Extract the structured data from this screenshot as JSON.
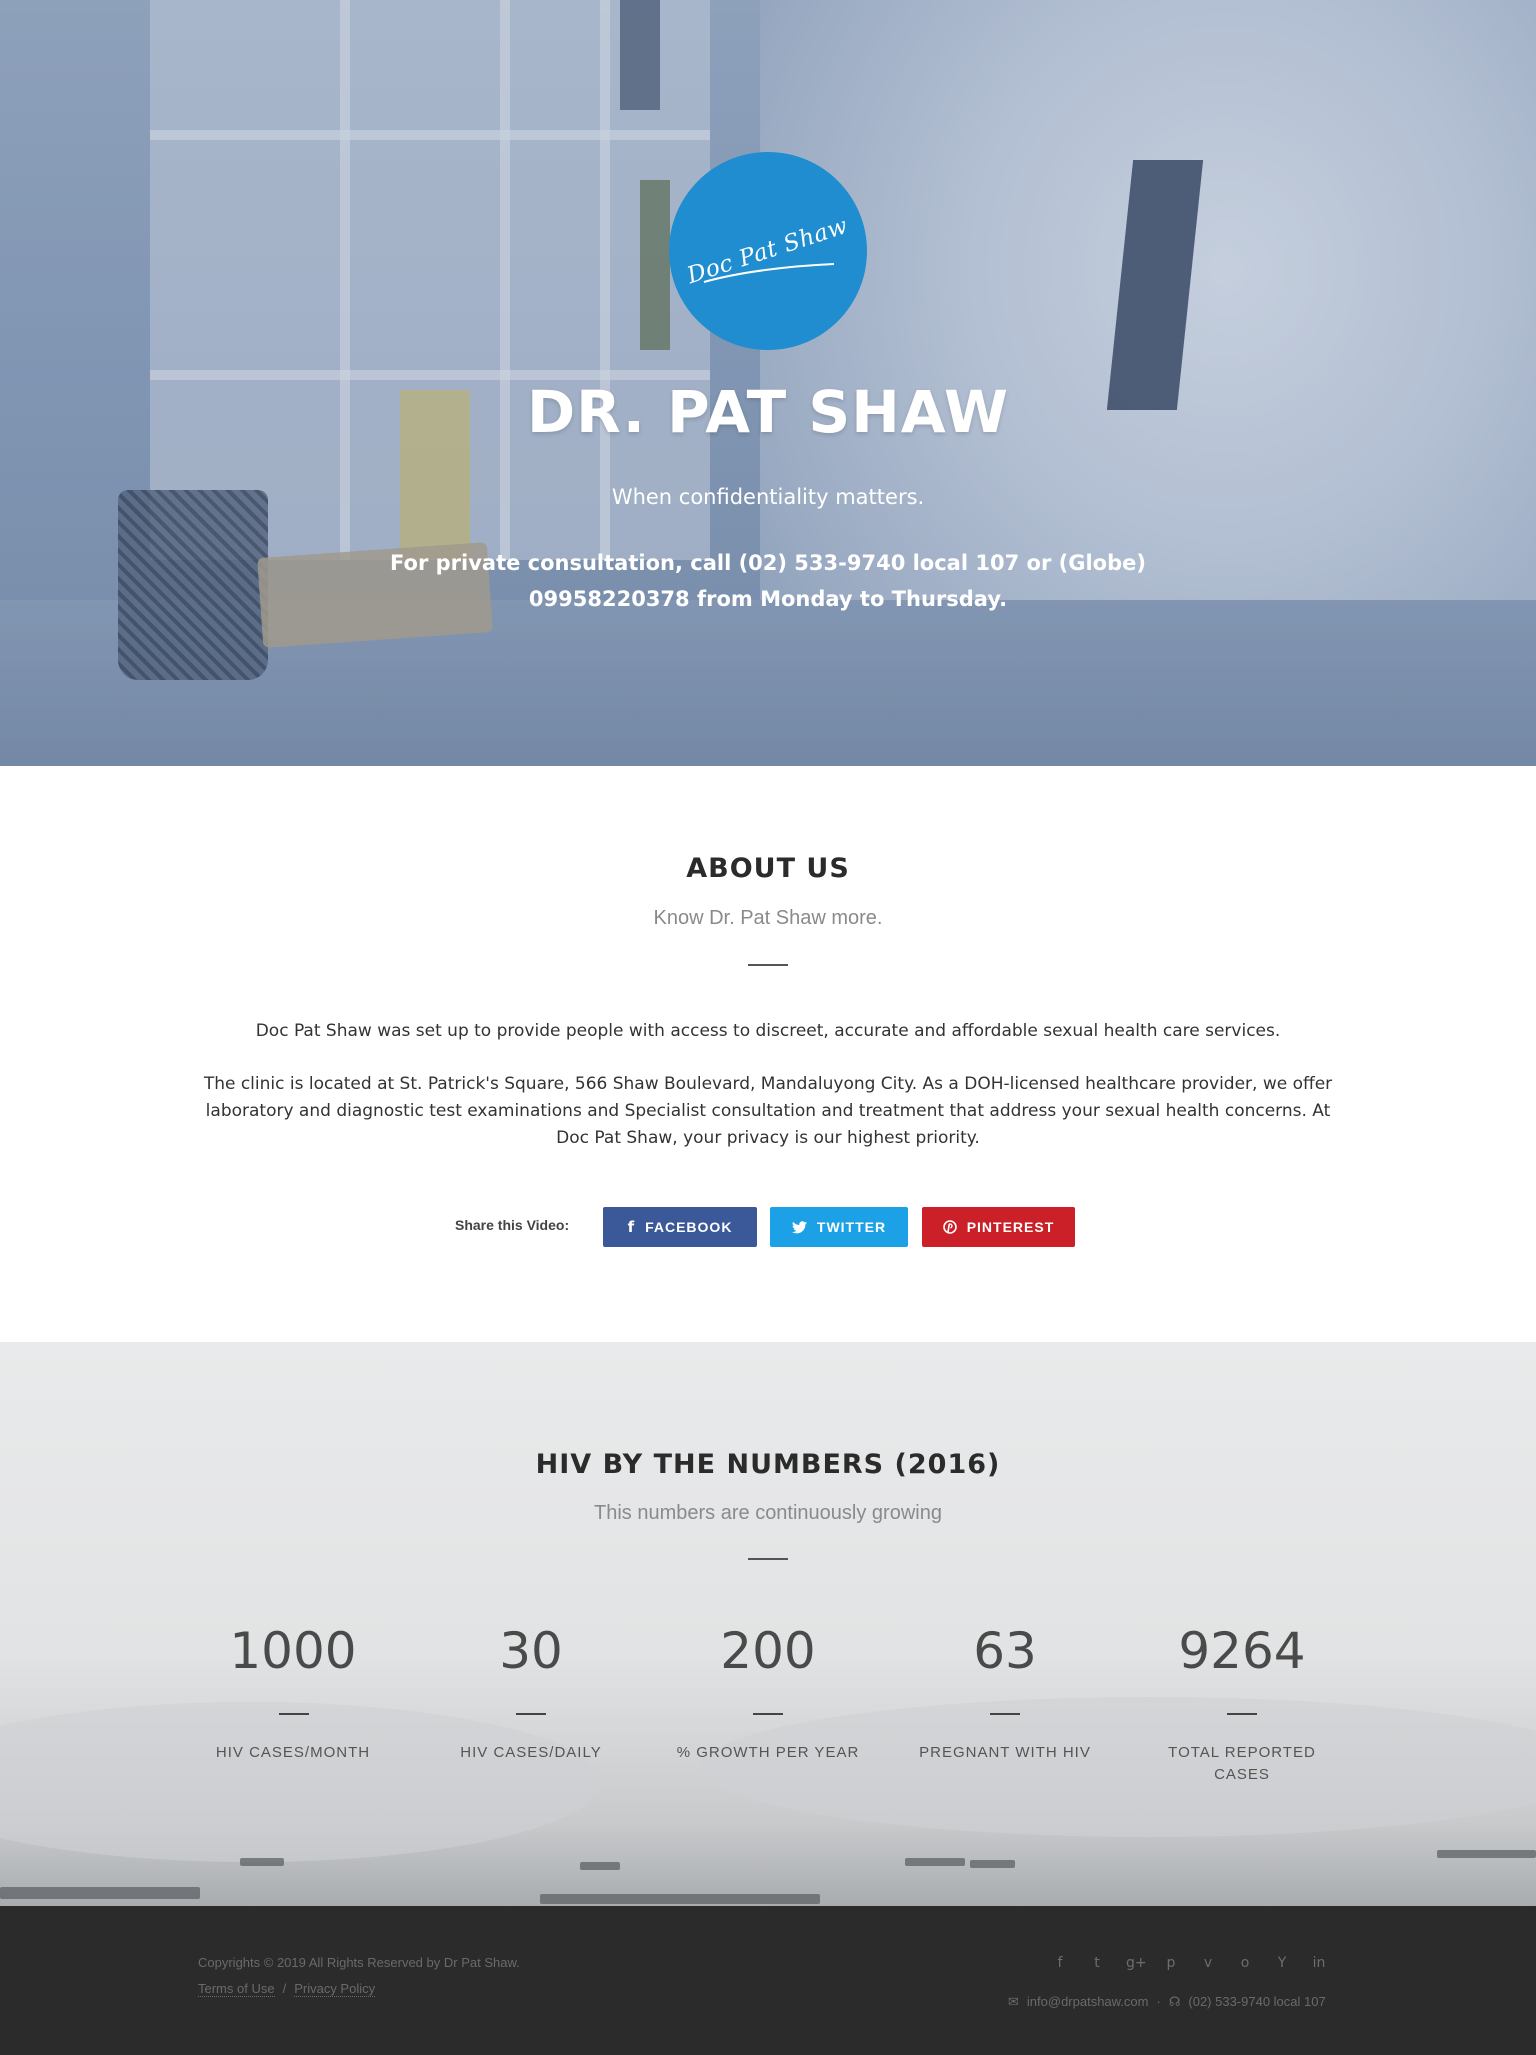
{
  "hero": {
    "logo_text": "Doc Pat Shaw",
    "title": "DR. PAT SHAW",
    "tagline": "When confidentiality matters.",
    "contact": "For private consultation, call (02) 533-9740 local 107 or (Globe) 09958220378 from Monday to Thursday."
  },
  "about": {
    "title": "ABOUT US",
    "subtitle": "Know Dr. Pat Shaw more.",
    "paragraph1": "Doc Pat Shaw was set up to provide people with access to discreet, accurate and affordable sexual health care services.",
    "paragraph2": "The clinic is located at St. Patrick's Square, 566 Shaw Boulevard, Mandaluyong City. As a DOH-licensed healthcare provider, we offer laboratory and diagnostic test examinations and Specialist consultation and treatment that address your sexual health concerns. At Doc Pat Shaw, your privacy is our highest priority.",
    "share_label": "Share this Video:",
    "share_buttons": [
      {
        "label": "FACEBOOK",
        "icon": "facebook-icon",
        "color": "#3b5998"
      },
      {
        "label": "TWITTER",
        "icon": "twitter-icon",
        "color": "#1da1e6"
      },
      {
        "label": "PINTEREST",
        "icon": "pinterest-icon",
        "color": "#cb2027"
      }
    ]
  },
  "numbers": {
    "title": "HIV BY THE NUMBERS (2016)",
    "subtitle": "This numbers are continuously growing",
    "stats": [
      {
        "value": "1000",
        "label": "HIV CASES/MONTH"
      },
      {
        "value": "30",
        "label": "HIV CASES/DAILY"
      },
      {
        "value": "200",
        "label": "% GROWTH PER YEAR"
      },
      {
        "value": "63",
        "label": "PREGNANT WITH HIV"
      },
      {
        "value": "9264",
        "label": "TOTAL REPORTED CASES"
      }
    ]
  },
  "footer": {
    "copyright": "Copyrights © 2019 All Rights Reserved by Dr Pat Shaw.",
    "terms": "Terms of Use",
    "separator": "/",
    "privacy": "Privacy Policy",
    "social_icons": [
      "facebook-icon",
      "twitter-icon",
      "google-plus-icon",
      "pinterest-icon",
      "vimeo-icon",
      "github-icon",
      "hacker-news-icon",
      "linkedin-icon"
    ],
    "email": "info@drpatshaw.com",
    "dot": "·",
    "phone": "(02) 533-9740 local 107"
  }
}
